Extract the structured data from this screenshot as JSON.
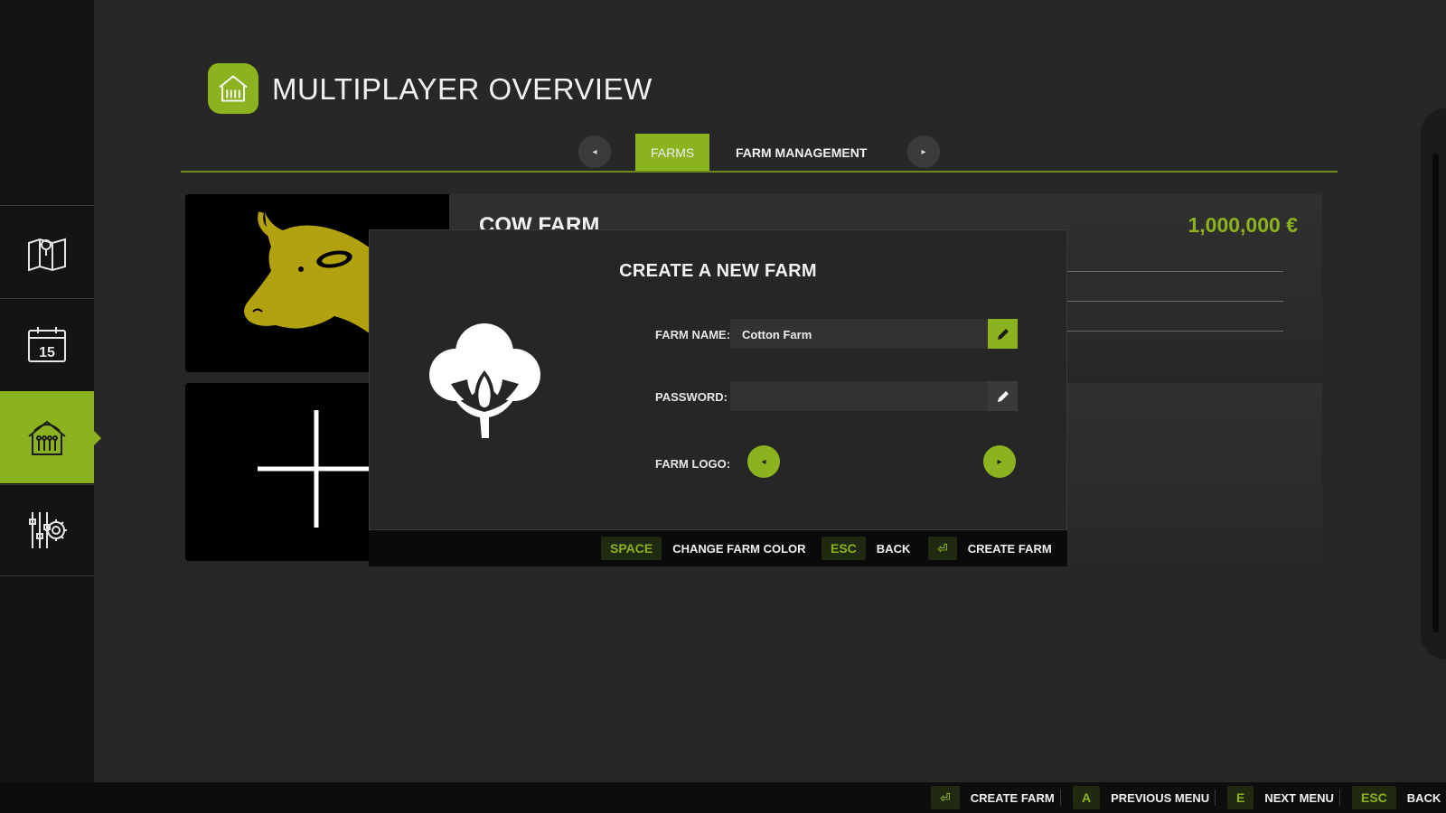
{
  "header": {
    "title": "MULTIPLAYER OVERVIEW",
    "icon": "barn-icon"
  },
  "sidebar": {
    "items": [
      {
        "name": "map",
        "icon": "map-icon",
        "active": false
      },
      {
        "name": "calendar",
        "icon": "calendar-icon",
        "label": "15",
        "active": false
      },
      {
        "name": "multiplayer",
        "icon": "barn-icon",
        "active": true
      },
      {
        "name": "settings",
        "icon": "settings-gear-icon",
        "active": false
      }
    ]
  },
  "tabs": {
    "items": [
      {
        "label": "FARMS",
        "active": true
      },
      {
        "label": "FARM MANAGEMENT",
        "active": false
      }
    ],
    "prev_icon": "◂",
    "next_icon": "▸"
  },
  "farms": [
    {
      "name": "COW FARM",
      "money": "1,000,000 €",
      "logo": "cow-icon"
    },
    {
      "name": "",
      "logo": "plus-icon"
    }
  ],
  "dialog": {
    "title": "CREATE A NEW FARM",
    "logo": "cotton-icon",
    "farm_name_label": "FARM NAME:",
    "farm_name_value": "Cotton Farm",
    "password_label": "PASSWORD:",
    "password_value": "",
    "farm_logo_label": "FARM LOGO:",
    "hints": [
      {
        "key": "SPACE",
        "label": "CHANGE FARM COLOR"
      },
      {
        "key": "ESC",
        "label": "BACK"
      },
      {
        "key": "⏎",
        "label": "CREATE FARM"
      }
    ]
  },
  "bottom_bar": {
    "hints": [
      {
        "key": "⏎",
        "label": "CREATE FARM"
      },
      {
        "key": "A",
        "label": "PREVIOUS MENU"
      },
      {
        "key": "E",
        "label": "NEXT MENU"
      },
      {
        "key": "ESC",
        "label": "BACK"
      }
    ]
  },
  "colors": {
    "accent": "#8bb21f",
    "background": "#272727",
    "sidebar": "#141414",
    "cow_logo": "#b3a20f"
  }
}
